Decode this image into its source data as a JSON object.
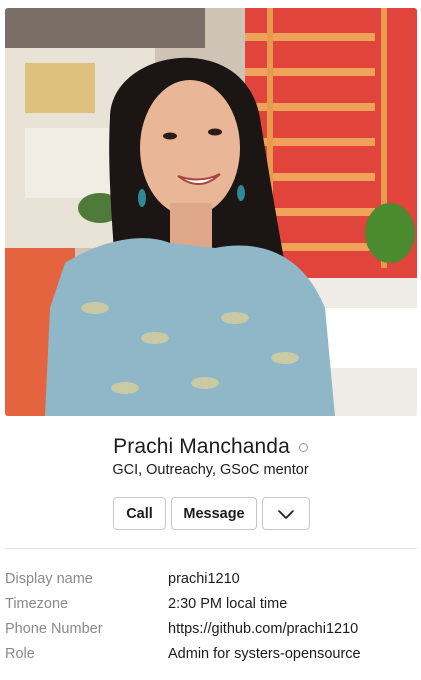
{
  "profile": {
    "name": "Prachi Manchanda",
    "title": "GCI, Outreachy, GSoC mentor",
    "presence": "away",
    "photo_icon": "profile-photo"
  },
  "actions": {
    "call_label": "Call",
    "message_label": "Message",
    "more_icon": "chevron-down-icon"
  },
  "fields": [
    {
      "label": "Display name",
      "value": "prachi1210"
    },
    {
      "label": "Timezone",
      "value": "2:30 PM local time"
    },
    {
      "label": "Phone Number",
      "value": "https://github.com/prachi1210"
    },
    {
      "label": "Role",
      "value": "Admin for systers-opensource"
    }
  ],
  "colors": {
    "presence_away": "#9a9a9a",
    "label_gray": "#8a8a8a",
    "text": "#1d1c1d"
  }
}
